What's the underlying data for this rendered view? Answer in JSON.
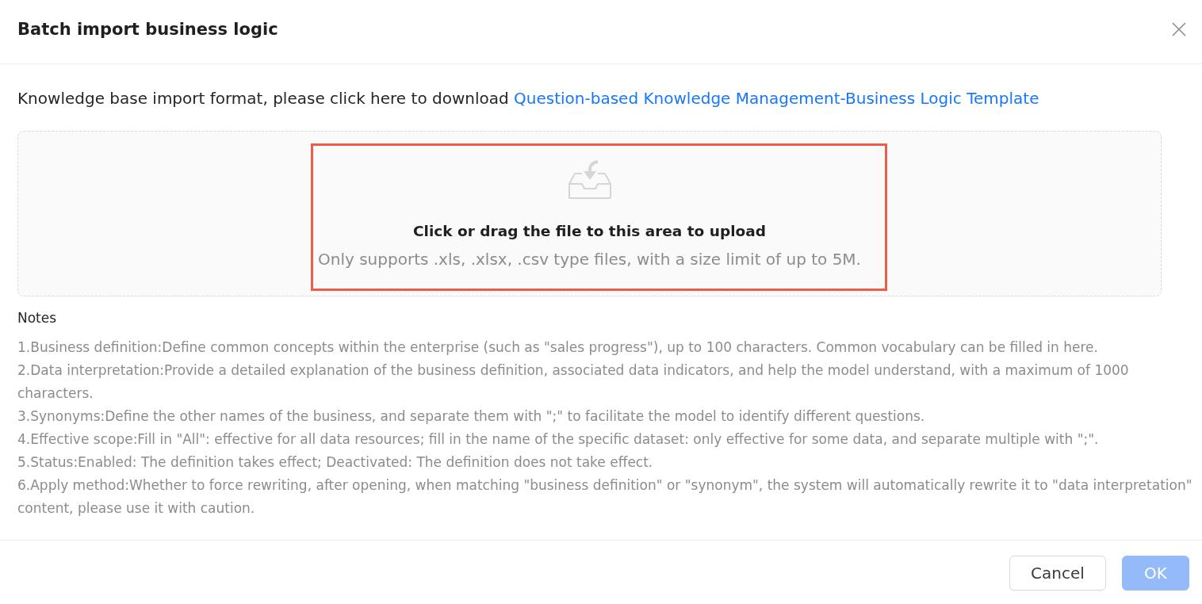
{
  "dialog": {
    "title": "Batch import business logic"
  },
  "download": {
    "text": "Knowledge base import format, please click here to download",
    "link": "Question-based Knowledge Management-Business Logic Template"
  },
  "upload": {
    "highlighted": true,
    "title": "Click or drag the file to this area to upload",
    "hint": "Only supports .xls, .xlsx, .csv type files, with a size limit of up to 5M."
  },
  "notes": {
    "label": "Notes",
    "items": [
      "1.Business definition:Define common concepts within the enterprise (such as \"sales progress\"), up to 100 characters. Common vocabulary can be filled in here.",
      "2.Data interpretation:Provide a detailed explanation of the business definition, associated data indicators, and help the model understand, with a maximum of 1000 characters.",
      "3.Synonyms:Define the other names of the business, and separate them with \";\" to facilitate the model to identify different questions.",
      "4.Effective scope:Fill in \"All\": effective for all data resources; fill in the name of the specific dataset: only effective for some data, and separate multiple with \";\".",
      "5.Status:Enabled: The definition takes effect; Deactivated: The definition does not take effect.",
      "6.Apply method:Whether to force rewriting, after opening, when matching \"business definition\" or \"synonym\", the system will automatically rewrite it to \"data interpretation\" content, please use it with caution."
    ]
  },
  "buttons": [
    {
      "label": "Cancel",
      "kind": "default",
      "disabled": false
    },
    {
      "label": "OK",
      "kind": "primary",
      "disabled": true
    }
  ]
}
